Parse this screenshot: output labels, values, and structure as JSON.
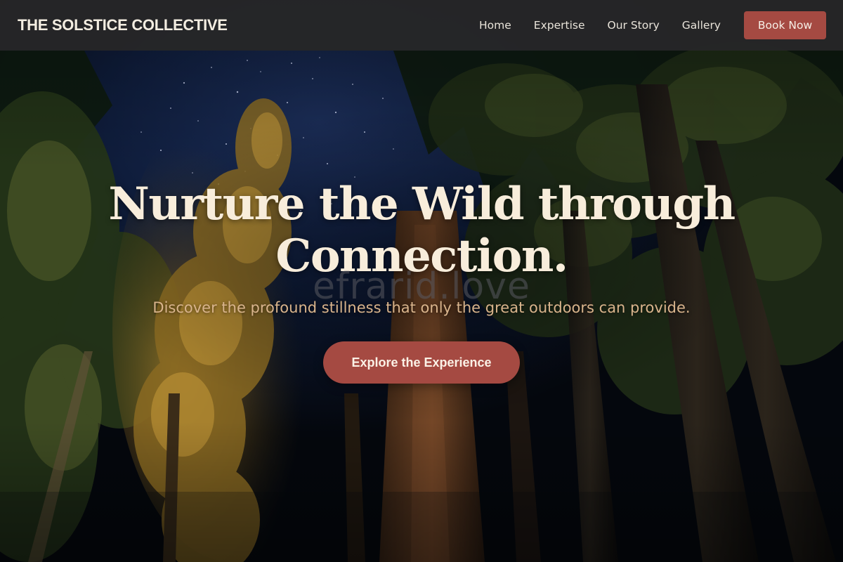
{
  "nav": {
    "brand": "THE SOLSTICE COLLECTIVE",
    "links": [
      {
        "label": "Home"
      },
      {
        "label": "Expertise"
      },
      {
        "label": "Our Story"
      },
      {
        "label": "Gallery"
      }
    ],
    "cta_label": "Book Now"
  },
  "hero": {
    "title_line1": "Nurture the Wild through",
    "title_line2": "Connection.",
    "subtitle": "Discover the profound stillness that only the great outdoors can provide.",
    "cta_label": "Explore the Experience",
    "watermark": "efrarid.love",
    "background": "night-forest-image"
  },
  "colors": {
    "nav_bg": "#262628",
    "accent": "#a54a42",
    "title": "#f8eddb",
    "subtitle": "#d9b48c",
    "sky": "#0f1d3c"
  }
}
